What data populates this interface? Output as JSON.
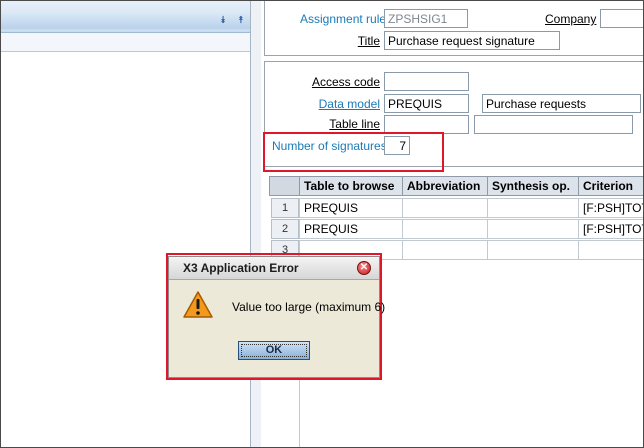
{
  "form": {
    "assignment_rule_label": "Assignment rule",
    "assignment_rule_value": "ZPSHSIG1",
    "company_label": "Company",
    "company_value": "",
    "title_label": "Title",
    "title_value": "Purchase request signature",
    "access_code_label": "Access code",
    "access_code_value": "",
    "data_model_label": "Data model",
    "data_model_value": "PREQUIS",
    "data_model_desc": "Purchase requests",
    "table_line_label": "Table line",
    "table_line_value": "",
    "table_line_value2": "",
    "num_signatures_label": "Number of signatures",
    "num_signatures_value": "7"
  },
  "grid": {
    "columns": [
      "Table to browse",
      "Abbreviation",
      "Synthesis op.",
      "Criterion"
    ],
    "rows": [
      {
        "num": "1",
        "table": "PREQUIS",
        "abbr": "",
        "synth": "",
        "criterion": "[F:PSH]TOTL"
      },
      {
        "num": "2",
        "table": "PREQUIS",
        "abbr": "",
        "synth": "",
        "criterion": "[F:PSH]TOTL"
      },
      {
        "num": "3",
        "table": "",
        "abbr": "",
        "synth": "",
        "criterion": ""
      }
    ]
  },
  "dialog": {
    "title": "X3 Application Error",
    "message": "Value too large (maximum 6)",
    "ok_label": "OK",
    "icon": "warning-icon"
  },
  "colors": {
    "highlight_red": "#e0162b",
    "link_blue": "#1a7ab8",
    "dialog_bg": "#ece9d8"
  }
}
